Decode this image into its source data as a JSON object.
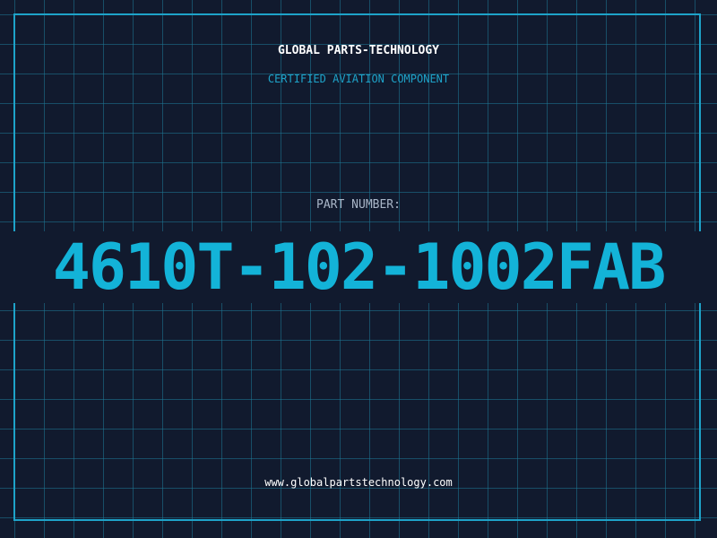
{
  "header": {
    "company": "GLOBAL PARTS-TECHNOLOGY",
    "tagline": "CERTIFIED AVIATION COMPONENT"
  },
  "part": {
    "label": "PART NUMBER:",
    "number": "4610T-102-1002FAB"
  },
  "footer": {
    "website": "www.globalpartstechnology.com"
  },
  "colors": {
    "background": "#111a2e",
    "grid": "#1e7896",
    "accent": "#13b3d8",
    "frame": "#1ea3c9"
  }
}
